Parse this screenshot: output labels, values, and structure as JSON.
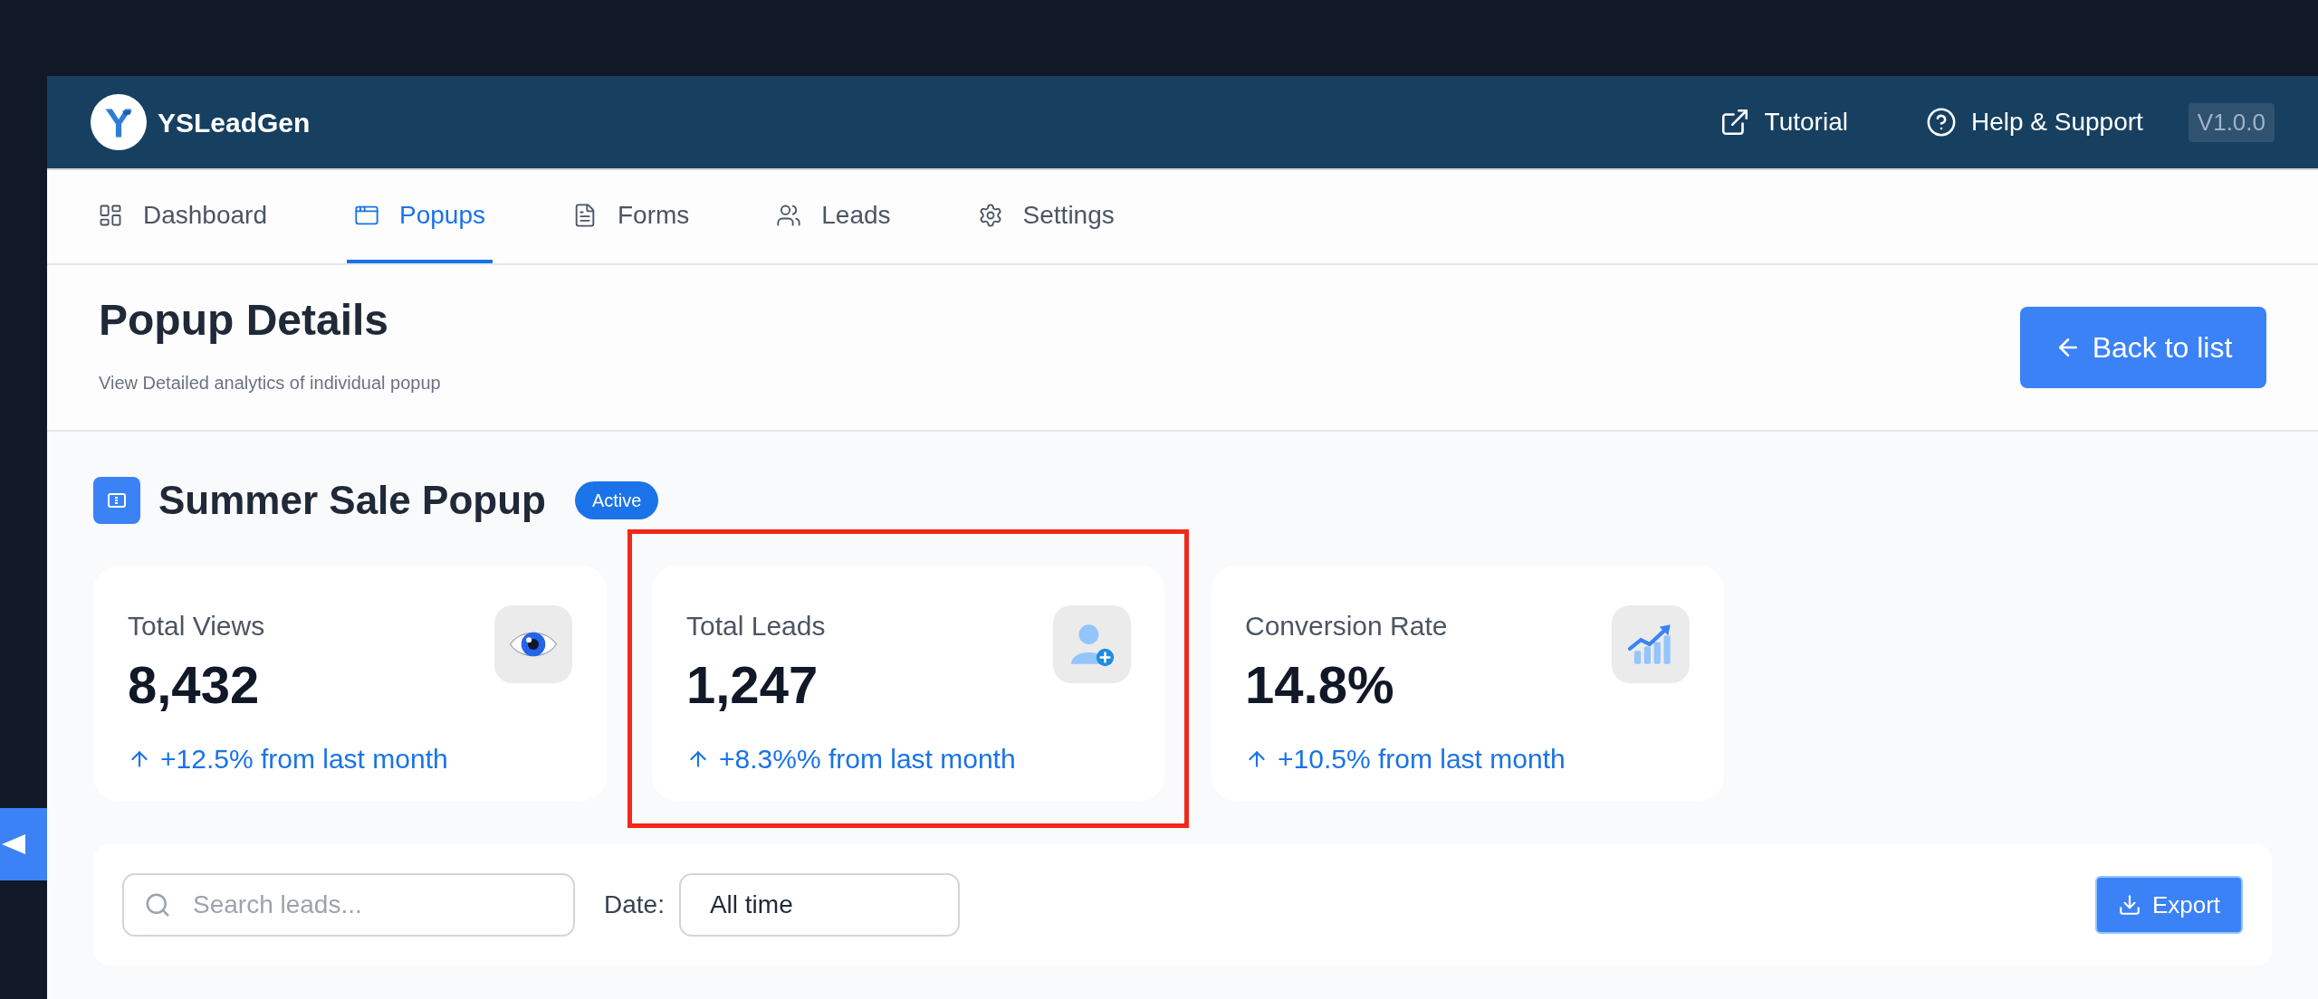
{
  "app": {
    "name": "YSLeadGen"
  },
  "header_links": [
    {
      "label": "Tutorial",
      "kind": "external"
    },
    {
      "label": "Help & Support",
      "kind": "help"
    }
  ],
  "version": "V1.0.0",
  "tabs": [
    {
      "label": "Dashboard",
      "kind": "dashboard",
      "selected": false
    },
    {
      "label": "Popups",
      "kind": "popups",
      "selected": true
    },
    {
      "label": "Forms",
      "kind": "forms",
      "selected": false
    },
    {
      "label": "Leads",
      "kind": "leads",
      "selected": false
    },
    {
      "label": "Settings",
      "kind": "settings",
      "selected": false
    }
  ],
  "page": {
    "title": "Popup Details",
    "subtitle": "View Detailed analytics of individual popup",
    "back_button": "Back to list"
  },
  "popup": {
    "name": "Summer Sale Popup",
    "status": "Active"
  },
  "stats": [
    {
      "label": "Total Views",
      "value": "8,432",
      "change": "+12.5% from last month",
      "kind": "views",
      "highlighted": false
    },
    {
      "label": "Total Leads",
      "value": "1,247",
      "change": "+8.3%% from last month",
      "kind": "leads",
      "highlighted": true
    },
    {
      "label": "Conversion Rate",
      "value": "14.8%",
      "change": "+10.5% from last month",
      "kind": "conversion",
      "highlighted": false
    }
  ],
  "filters": {
    "search": {
      "placeholder": "Search leads..."
    },
    "date": {
      "label": "Date:",
      "value": "All time"
    },
    "export": "Export"
  }
}
